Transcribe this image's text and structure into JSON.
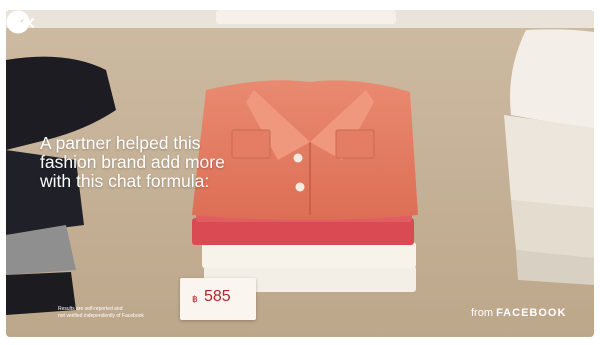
{
  "headline": {
    "line1": "A partner helped this",
    "line2": "fashion brand add more",
    "line3": "with this chat formula:"
  },
  "price_tag": {
    "currency": "฿",
    "value": "585"
  },
  "disclaimer": {
    "line1": "Results are self-reported and",
    "line2": "not verified independently of Facebook"
  },
  "branding": {
    "prefix": "from",
    "brand": "FACEBOOK"
  },
  "icons": {
    "messenger": "messenger-icon",
    "mute": "speaker-muted-icon"
  },
  "colors": {
    "headline_text": "#ffffff",
    "price_text": "#b0272c",
    "shirt": "#e4785e"
  }
}
